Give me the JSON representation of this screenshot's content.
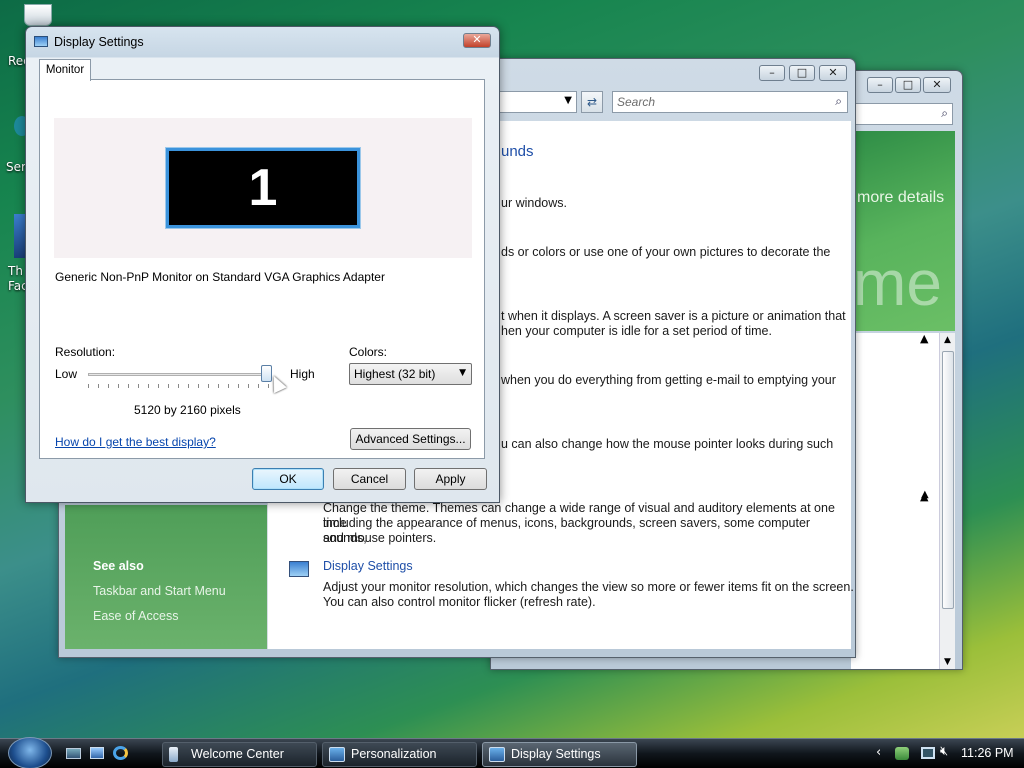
{
  "desktop": {
    "icons": [
      {
        "label": "Rec"
      },
      {
        "label": "Serj"
      },
      {
        "label": "Th"
      },
      {
        "label": "Fac"
      }
    ]
  },
  "welcome_window": {
    "search_icon": "search-icon",
    "right_text": "more details",
    "big_text": "me"
  },
  "personalization": {
    "search_placeholder": "Search",
    "heading_fragment": "unds",
    "items": [
      {
        "text": "ur windows."
      },
      {
        "text": "ds or colors or use one of your own pictures to decorate the"
      },
      {
        "text1": "t when it displays. A screen saver is a picture or animation that",
        "text2": "hen your computer is idle for a set period of time."
      },
      {
        "text": "when you do everything from getting e-mail to emptying your"
      },
      {
        "text": "u can also change how the mouse pointer looks during such"
      }
    ],
    "theme_text1": "Change the theme. Themes can change a wide range of visual and auditory elements at one time",
    "theme_text2": "including the appearance of menus, icons, backgrounds, screen savers, some computer sounds,",
    "theme_text3": "and mouse pointers.",
    "display_link": "Display Settings",
    "display_text1": "Adjust your monitor resolution, which changes the view so more or fewer items fit on the screen.",
    "display_text2": "You can also control monitor flicker (refresh rate).",
    "see_also": "See also",
    "see_links": [
      "Taskbar and Start Menu",
      "Ease of Access"
    ]
  },
  "dialog": {
    "title": "Display Settings",
    "tab": "Monitor",
    "monitor_number": "1",
    "monitor_desc": "Generic Non-PnP Monitor on Standard VGA Graphics Adapter",
    "resolution_label": "Resolution:",
    "low": "Low",
    "high": "High",
    "resolution_value": "5120 by 2160 pixels",
    "slider_level": 1.0,
    "colors_label": "Colors:",
    "colors_value": "Highest (32 bit)",
    "help_link": "How do I get the best display?",
    "advanced": "Advanced Settings...",
    "ok": "OK",
    "cancel": "Cancel",
    "apply": "Apply"
  },
  "taskbar": {
    "items": [
      "Welcome Center",
      "Personalization",
      "Display Settings"
    ],
    "clock": "11:26 PM"
  }
}
